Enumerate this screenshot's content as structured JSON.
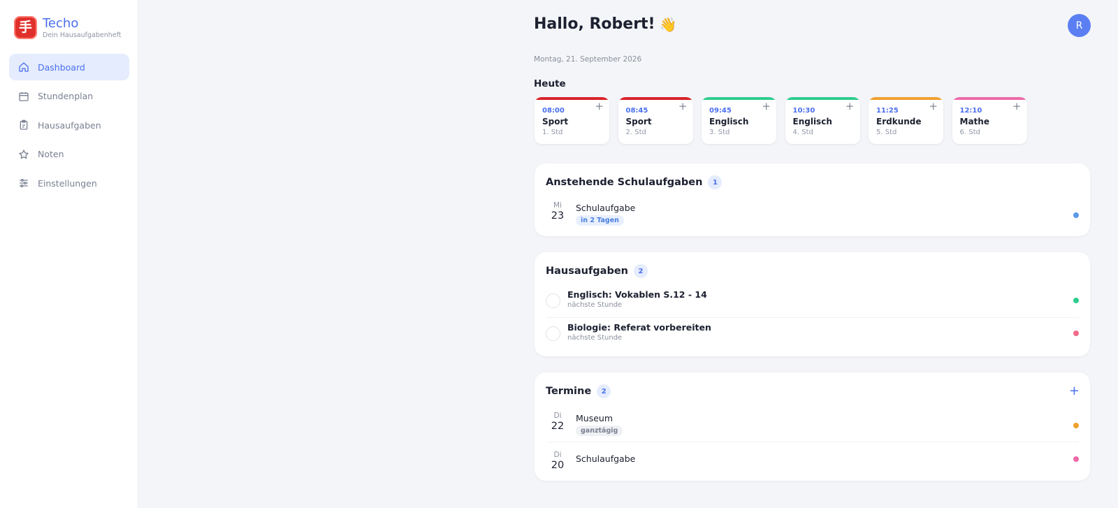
{
  "brand": {
    "logo_glyph": "手",
    "title": "Techo",
    "subtitle": "Dein Hausaufgabenheft",
    "accent": "#4a6ff0",
    "logo_color": "#e0302b"
  },
  "nav": [
    {
      "label": "Dashboard",
      "icon": "home-icon",
      "active": true
    },
    {
      "label": "Stundenplan",
      "icon": "calendar-icon",
      "active": false
    },
    {
      "label": "Hausaufgaben",
      "icon": "clipboard-icon",
      "active": false
    },
    {
      "label": "Noten",
      "icon": "star-icon",
      "active": false
    },
    {
      "label": "Einstellungen",
      "icon": "sliders-icon",
      "active": false
    }
  ],
  "header": {
    "greeting": "Hallo, Robert!",
    "wave": "👋",
    "date": "Montag, 21. September 2026",
    "avatar_initial": "R"
  },
  "today": {
    "label": "Heute",
    "add_symbol": "+",
    "lessons": [
      {
        "time": "08:00",
        "subject": "Sport",
        "slot": "1. Std",
        "color": "#d8232a"
      },
      {
        "time": "08:45",
        "subject": "Sport",
        "slot": "2. Std",
        "color": "#d8232a"
      },
      {
        "time": "09:45",
        "subject": "Englisch",
        "slot": "3. Std",
        "color": "#2ecc8f"
      },
      {
        "time": "10:30",
        "subject": "Englisch",
        "slot": "4. Std",
        "color": "#2ecc8f"
      },
      {
        "time": "11:25",
        "subject": "Erdkunde",
        "slot": "5. Std",
        "color": "#f0a030"
      },
      {
        "time": "12:10",
        "subject": "Mathe",
        "slot": "6. Std",
        "color": "#ec6aa8"
      }
    ]
  },
  "exams": {
    "title": "Anstehende Schulaufgaben",
    "count": "1",
    "items": [
      {
        "weekday": "Mi",
        "day": "23",
        "title": "Schulaufgabe",
        "tag": "in 2 Tagen",
        "dot_color": "#5b9ae8"
      }
    ]
  },
  "homework": {
    "title": "Hausaufgaben",
    "count": "2",
    "items": [
      {
        "title": "Englisch: Vokablen S.12 - 14",
        "sub": "nächste Stunde",
        "dot_color": "#2ecc8f"
      },
      {
        "title": "Biologie: Referat vorbereiten",
        "sub": "nächste Stunde",
        "dot_color": "#f06a8a"
      }
    ]
  },
  "events": {
    "title": "Termine",
    "count": "2",
    "add_symbol": "+",
    "items": [
      {
        "weekday": "Di",
        "day": "22",
        "title": "Museum",
        "tag": "ganztägig",
        "dot_color": "#f0a030"
      },
      {
        "weekday": "Di",
        "day": "20",
        "title": "Schulaufgabe",
        "tag": "",
        "dot_color": "#ec6aa8"
      }
    ]
  }
}
